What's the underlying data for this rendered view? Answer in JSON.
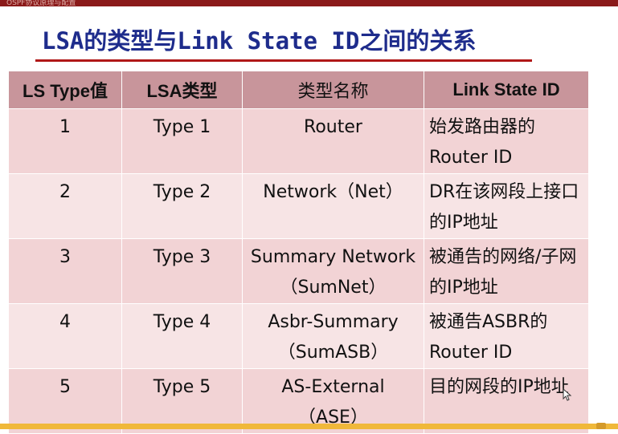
{
  "slide": {
    "header_text": "OSPF协议原理与配置",
    "title": "LSA的类型与Link State ID之间的关系"
  },
  "table": {
    "headers": [
      "LS Type值",
      "LSA类型",
      "类型名称",
      "Link State ID"
    ],
    "rows": [
      {
        "ls_type": "1",
        "lsa_type": "Type 1",
        "name_line1": "Router",
        "name_line2": "",
        "id_line1": "始发路由器的",
        "id_line2": "Router ID"
      },
      {
        "ls_type": "2",
        "lsa_type": "Type 2",
        "name_line1": "Network（Net）",
        "name_line2": "",
        "id_line1": "DR在该网段上接口",
        "id_line2": "的IP地址"
      },
      {
        "ls_type": "3",
        "lsa_type": "Type 3",
        "name_line1": "Summary Network",
        "name_line2": "（SumNet）",
        "id_line1": "被通告的网络/子网",
        "id_line2": "的IP地址"
      },
      {
        "ls_type": "4",
        "lsa_type": "Type 4",
        "name_line1": "Asbr-Summary",
        "name_line2": "（SumASB）",
        "id_line1": "被通告ASBR的",
        "id_line2": "Router ID"
      },
      {
        "ls_type": "5",
        "lsa_type": "Type 5",
        "name_line1": "AS-External",
        "name_line2": "（ASE）",
        "id_line1": "目的网段的IP地址",
        "id_line2": ""
      }
    ]
  },
  "colors": {
    "title": "#1e2c8c",
    "underline": "#b01818",
    "header_bg": "#c8959b",
    "row_bg": "#f2d3d5",
    "top_bar": "#8b1a1a",
    "bottom_bar": "#f0b83a"
  },
  "icons": {
    "cursor": "mouse-pointer-icon"
  }
}
